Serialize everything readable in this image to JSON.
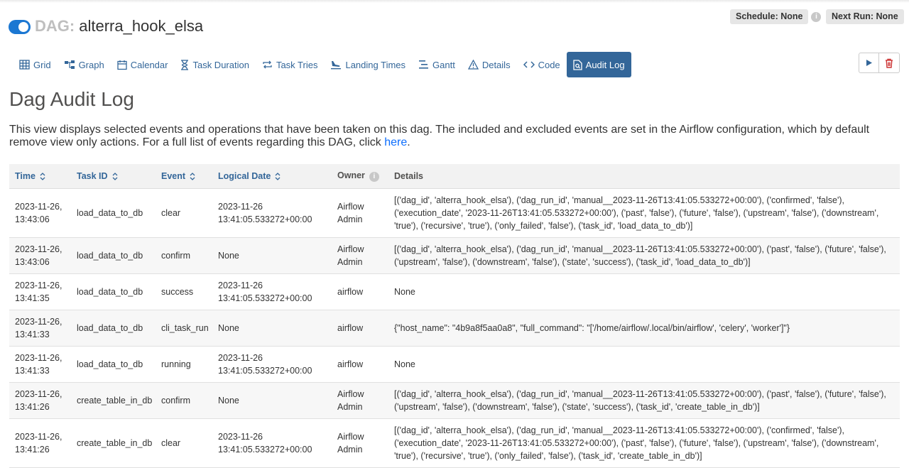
{
  "header": {
    "dag_label": "DAG:",
    "dag_name": "alterra_hook_elsa",
    "schedule": "Schedule: None",
    "next_run": "Next Run: None"
  },
  "tabs": [
    {
      "label": "Grid",
      "icon": "grid-icon"
    },
    {
      "label": "Graph",
      "icon": "graph-icon"
    },
    {
      "label": "Calendar",
      "icon": "calendar-icon"
    },
    {
      "label": "Task Duration",
      "icon": "hourglass-icon"
    },
    {
      "label": "Task Tries",
      "icon": "repeat-icon"
    },
    {
      "label": "Landing Times",
      "icon": "landing-icon"
    },
    {
      "label": "Gantt",
      "icon": "gantt-icon"
    },
    {
      "label": "Details",
      "icon": "warning-icon"
    },
    {
      "label": "Code",
      "icon": "code-icon"
    },
    {
      "label": "Audit Log",
      "icon": "file-search-icon",
      "active": true
    }
  ],
  "page": {
    "title": "Dag Audit Log",
    "description": "This view displays selected events and operations that have been taken on this dag. The included and excluded events are set in the Airflow configuration, which by default remove view only actions. For a full list of events regarding this DAG, click ",
    "link_text": "here",
    "description_end": "."
  },
  "table": {
    "columns": {
      "time": "Time",
      "task_id": "Task ID",
      "event": "Event",
      "logical_date": "Logical Date",
      "owner": "Owner",
      "details": "Details"
    },
    "rows": [
      {
        "time": "2023-11-26, 13:43:06",
        "task_id": "load_data_to_db",
        "event": "clear",
        "logical_date": "2023-11-26 13:41:05.533272+00:00",
        "owner": "Airflow Admin",
        "details": "[('dag_id', 'alterra_hook_elsa'), ('dag_run_id', 'manual__2023-11-26T13:41:05.533272+00:00'), ('confirmed', 'false'), ('execution_date', '2023-11-26T13:41:05.533272+00:00'), ('past', 'false'), ('future', 'false'), ('upstream', 'false'), ('downstream', 'true'), ('recursive', 'true'), ('only_failed', 'false'), ('task_id', 'load_data_to_db')]"
      },
      {
        "time": "2023-11-26, 13:43:06",
        "task_id": "load_data_to_db",
        "event": "confirm",
        "logical_date": "None",
        "owner": "Airflow Admin",
        "details": "[('dag_id', 'alterra_hook_elsa'), ('dag_run_id', 'manual__2023-11-26T13:41:05.533272+00:00'), ('past', 'false'), ('future', 'false'), ('upstream', 'false'), ('downstream', 'false'), ('state', 'success'), ('task_id', 'load_data_to_db')]"
      },
      {
        "time": "2023-11-26, 13:41:35",
        "task_id": "load_data_to_db",
        "event": "success",
        "logical_date": "2023-11-26 13:41:05.533272+00:00",
        "owner": "airflow",
        "details": "None"
      },
      {
        "time": "2023-11-26, 13:41:33",
        "task_id": "load_data_to_db",
        "event": "cli_task_run",
        "logical_date": "None",
        "owner": "airflow",
        "details": "{\"host_name\": \"4b9a8f5aa0a8\", \"full_command\": \"['/home/airflow/.local/bin/airflow', 'celery', 'worker']\"}"
      },
      {
        "time": "2023-11-26, 13:41:33",
        "task_id": "load_data_to_db",
        "event": "running",
        "logical_date": "2023-11-26 13:41:05.533272+00:00",
        "owner": "airflow",
        "details": "None"
      },
      {
        "time": "2023-11-26, 13:41:26",
        "task_id": "create_table_in_db",
        "event": "confirm",
        "logical_date": "None",
        "owner": "Airflow Admin",
        "details": "[('dag_id', 'alterra_hook_elsa'), ('dag_run_id', 'manual__2023-11-26T13:41:05.533272+00:00'), ('past', 'false'), ('future', 'false'), ('upstream', 'false'), ('downstream', 'false'), ('state', 'success'), ('task_id', 'create_table_in_db')]"
      },
      {
        "time": "2023-11-26, 13:41:26",
        "task_id": "create_table_in_db",
        "event": "clear",
        "logical_date": "2023-11-26 13:41:05.533272+00:00",
        "owner": "Airflow Admin",
        "details": "[('dag_id', 'alterra_hook_elsa'), ('dag_run_id', 'manual__2023-11-26T13:41:05.533272+00:00'), ('confirmed', 'false'), ('execution_date', '2023-11-26T13:41:05.533272+00:00'), ('past', 'false'), ('future', 'false'), ('upstream', 'false'), ('downstream', 'true'), ('recursive', 'true'), ('only_failed', 'false'), ('task_id', 'create_table_in_db')]"
      }
    ]
  },
  "colors": {
    "accent": "#336699",
    "toggle_on": "#1b77d2",
    "delete": "#cc3333"
  }
}
